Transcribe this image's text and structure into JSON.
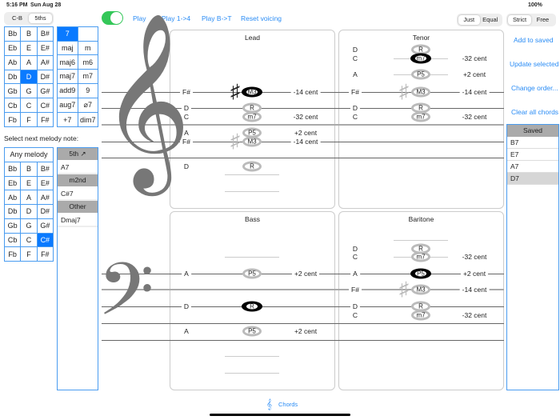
{
  "status": {
    "time": "5:16 PM",
    "date": "Sun Aug 28",
    "battery": "100%"
  },
  "order_seg": [
    "C-B",
    "5ths"
  ],
  "root_grid": [
    "Bb",
    "B",
    "B#",
    "Eb",
    "E",
    "E#",
    "Ab",
    "A",
    "A#",
    "Db",
    "D",
    "D#",
    "Gb",
    "G",
    "G#",
    "Cb",
    "C",
    "C#",
    "Fb",
    "F",
    "F#"
  ],
  "root_selected": "D",
  "chord_types": [
    "7",
    "",
    "maj",
    "m",
    "maj6",
    "m6",
    "maj7",
    "m7",
    "add9",
    "9",
    "aug7",
    "⌀7",
    "+7",
    "dim7"
  ],
  "chord_selected": "7",
  "toolbar": {
    "play": "Play",
    "play14": "Play 1->4",
    "playBT": "Play B->T",
    "reset": "Reset voicing",
    "toggle_on": true
  },
  "tuning_seg": [
    "Just",
    "Equal"
  ],
  "mode_seg": [
    "Strict",
    "Free"
  ],
  "melody_prompt": "Select next melody note:",
  "melody_any": "Any melody",
  "melody_grid": [
    "Bb",
    "B",
    "B#",
    "Eb",
    "E",
    "E#",
    "Ab",
    "A",
    "A#",
    "Db",
    "D",
    "D#",
    "Gb",
    "G",
    "G#",
    "Cb",
    "C",
    "C#",
    "Fb",
    "F",
    "F#"
  ],
  "melody_selected": "C#",
  "suggestions": [
    {
      "header": "5th ↗",
      "items": [
        "A7"
      ]
    },
    {
      "header": "m2nd",
      "items": [
        "C#7"
      ]
    },
    {
      "header": "Other",
      "items": [
        "Dmaj7"
      ]
    }
  ],
  "panels": [
    {
      "title": "Lead",
      "notes": [
        {
          "n": "F#",
          "i": "M3",
          "c": "-14 cent"
        },
        {
          "n": "D",
          "i": "R",
          "c": ""
        },
        {
          "n": "C",
          "i": "m7",
          "c": "-32 cent"
        },
        {
          "n": "A",
          "i": "P5",
          "c": "+2 cent"
        },
        {
          "n": "F#",
          "i": "M3",
          "c": "-14 cent"
        },
        {
          "n": "D",
          "i": "R",
          "c": ""
        }
      ]
    },
    {
      "title": "Tenor",
      "notes": [
        {
          "n": "D",
          "i": "R",
          "c": ""
        },
        {
          "n": "C",
          "i": "m7",
          "c": "-32 cent"
        },
        {
          "n": "A",
          "i": "P5",
          "c": "+2 cent"
        },
        {
          "n": "F#",
          "i": "M3",
          "c": "-14 cent"
        },
        {
          "n": "D",
          "i": "R",
          "c": ""
        },
        {
          "n": "C",
          "i": "m7",
          "c": "-32 cent"
        }
      ]
    },
    {
      "title": "Bass",
      "notes": [
        {
          "n": "A",
          "i": "P5",
          "c": "+2 cent"
        },
        {
          "n": "D",
          "i": "R",
          "c": ""
        },
        {
          "n": "A",
          "i": "P5",
          "c": "+2 cent"
        }
      ]
    },
    {
      "title": "Baritone",
      "notes": [
        {
          "n": "D",
          "i": "R",
          "c": ""
        },
        {
          "n": "C",
          "i": "m7",
          "c": "-32 cent"
        },
        {
          "n": "A",
          "i": "P5",
          "c": "+2 cent"
        },
        {
          "n": "F#",
          "i": "M3",
          "c": "-14 cent"
        },
        {
          "n": "D",
          "i": "R",
          "c": ""
        },
        {
          "n": "C",
          "i": "m7",
          "c": "-32 cent"
        }
      ]
    }
  ],
  "actions": {
    "add": "Add to saved",
    "update": "Update selected",
    "order": "Change order...",
    "clear": "Clear all chords"
  },
  "saved": {
    "header": "Saved",
    "items": [
      "B7",
      "E7",
      "A7",
      "D7"
    ],
    "selected": "D7"
  },
  "tab": {
    "label": "Chords"
  },
  "accent": "#0a7aff"
}
